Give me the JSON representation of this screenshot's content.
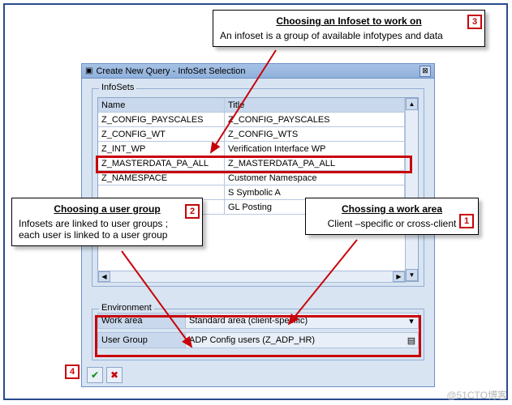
{
  "window": {
    "title": "Create New Query - InfoSet Selection"
  },
  "infosets": {
    "group_label": "InfoSets",
    "headers": {
      "name": "Name",
      "title": "Title"
    },
    "rows": [
      {
        "name": "Z_CONFIG_PAYSCALES",
        "title": "Z_CONFIG_PAYSCALES"
      },
      {
        "name": "Z_CONFIG_WT",
        "title": "Z_CONFIG_WTS"
      },
      {
        "name": "Z_INT_WP",
        "title": "Verification Interface  WP"
      },
      {
        "name": "Z_MASTERDATA_PA_ALL",
        "title": "Z_MASTERDATA_PA_ALL"
      },
      {
        "name": "Z_NAMESPACE",
        "title": "Customer Namespace"
      },
      {
        "name": "",
        "title": "S  Symbolic A"
      },
      {
        "name": "",
        "title": "GL Posting"
      }
    ]
  },
  "env": {
    "group_label": "Environment",
    "work_area_label": "Work area",
    "work_area_value": "Standard area (client-specific)",
    "user_group_label": "User Group",
    "user_group_value": "ADP Config users     (Z_ADP_HR)"
  },
  "callouts": {
    "c3_head": "Choosing an Infoset to work on",
    "c3_body": "An infoset is a group of available infotypes and data",
    "c2_head": "Choosing a user group",
    "c2_body1": "Infosets are linked to user groups ;",
    "c2_body2": "each user is linked to a user group",
    "c1_head": "Chossing a work area",
    "c1_body": "Client –specific or cross-client"
  },
  "badges": {
    "b1": "1",
    "b2": "2",
    "b3": "3",
    "b4": "4"
  },
  "watermark": "@51CTO博客"
}
